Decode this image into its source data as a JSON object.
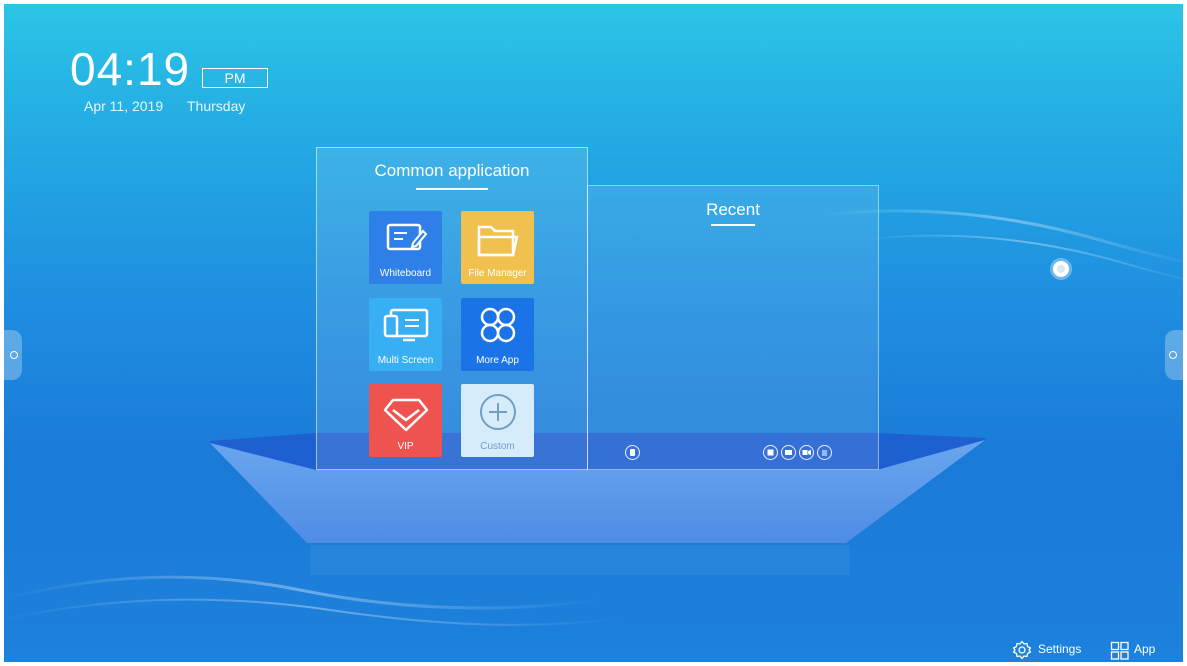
{
  "clock": {
    "time": "04:19",
    "ampm": "PM",
    "date": "Apr 11, 2019",
    "weekday": "Thursday"
  },
  "common_panel": {
    "title": "Common application",
    "apps": [
      {
        "label": "Whiteboard",
        "icon": "whiteboard-icon",
        "color": "#2f7fe8"
      },
      {
        "label": "File Manager",
        "icon": "folder-icon",
        "color": "#f0c14f"
      },
      {
        "label": "Multi Screen",
        "icon": "multi-screen-icon",
        "color": "#38aef3"
      },
      {
        "label": "More App",
        "icon": "more-app-icon",
        "color": "#1b73e8"
      },
      {
        "label": "VIP",
        "icon": "vip-diamond-icon",
        "color": "#ef5350"
      },
      {
        "label": "Custom",
        "icon": "plus-circle-icon",
        "color": "#d6ecfb"
      }
    ]
  },
  "recent_panel": {
    "title": "Recent",
    "icons": [
      "clear-recent-icon",
      "window-icon",
      "browser-icon",
      "camera-icon",
      "menu-icon"
    ]
  },
  "bottom_bar": {
    "settings_label": "Settings",
    "app_label": "App"
  }
}
